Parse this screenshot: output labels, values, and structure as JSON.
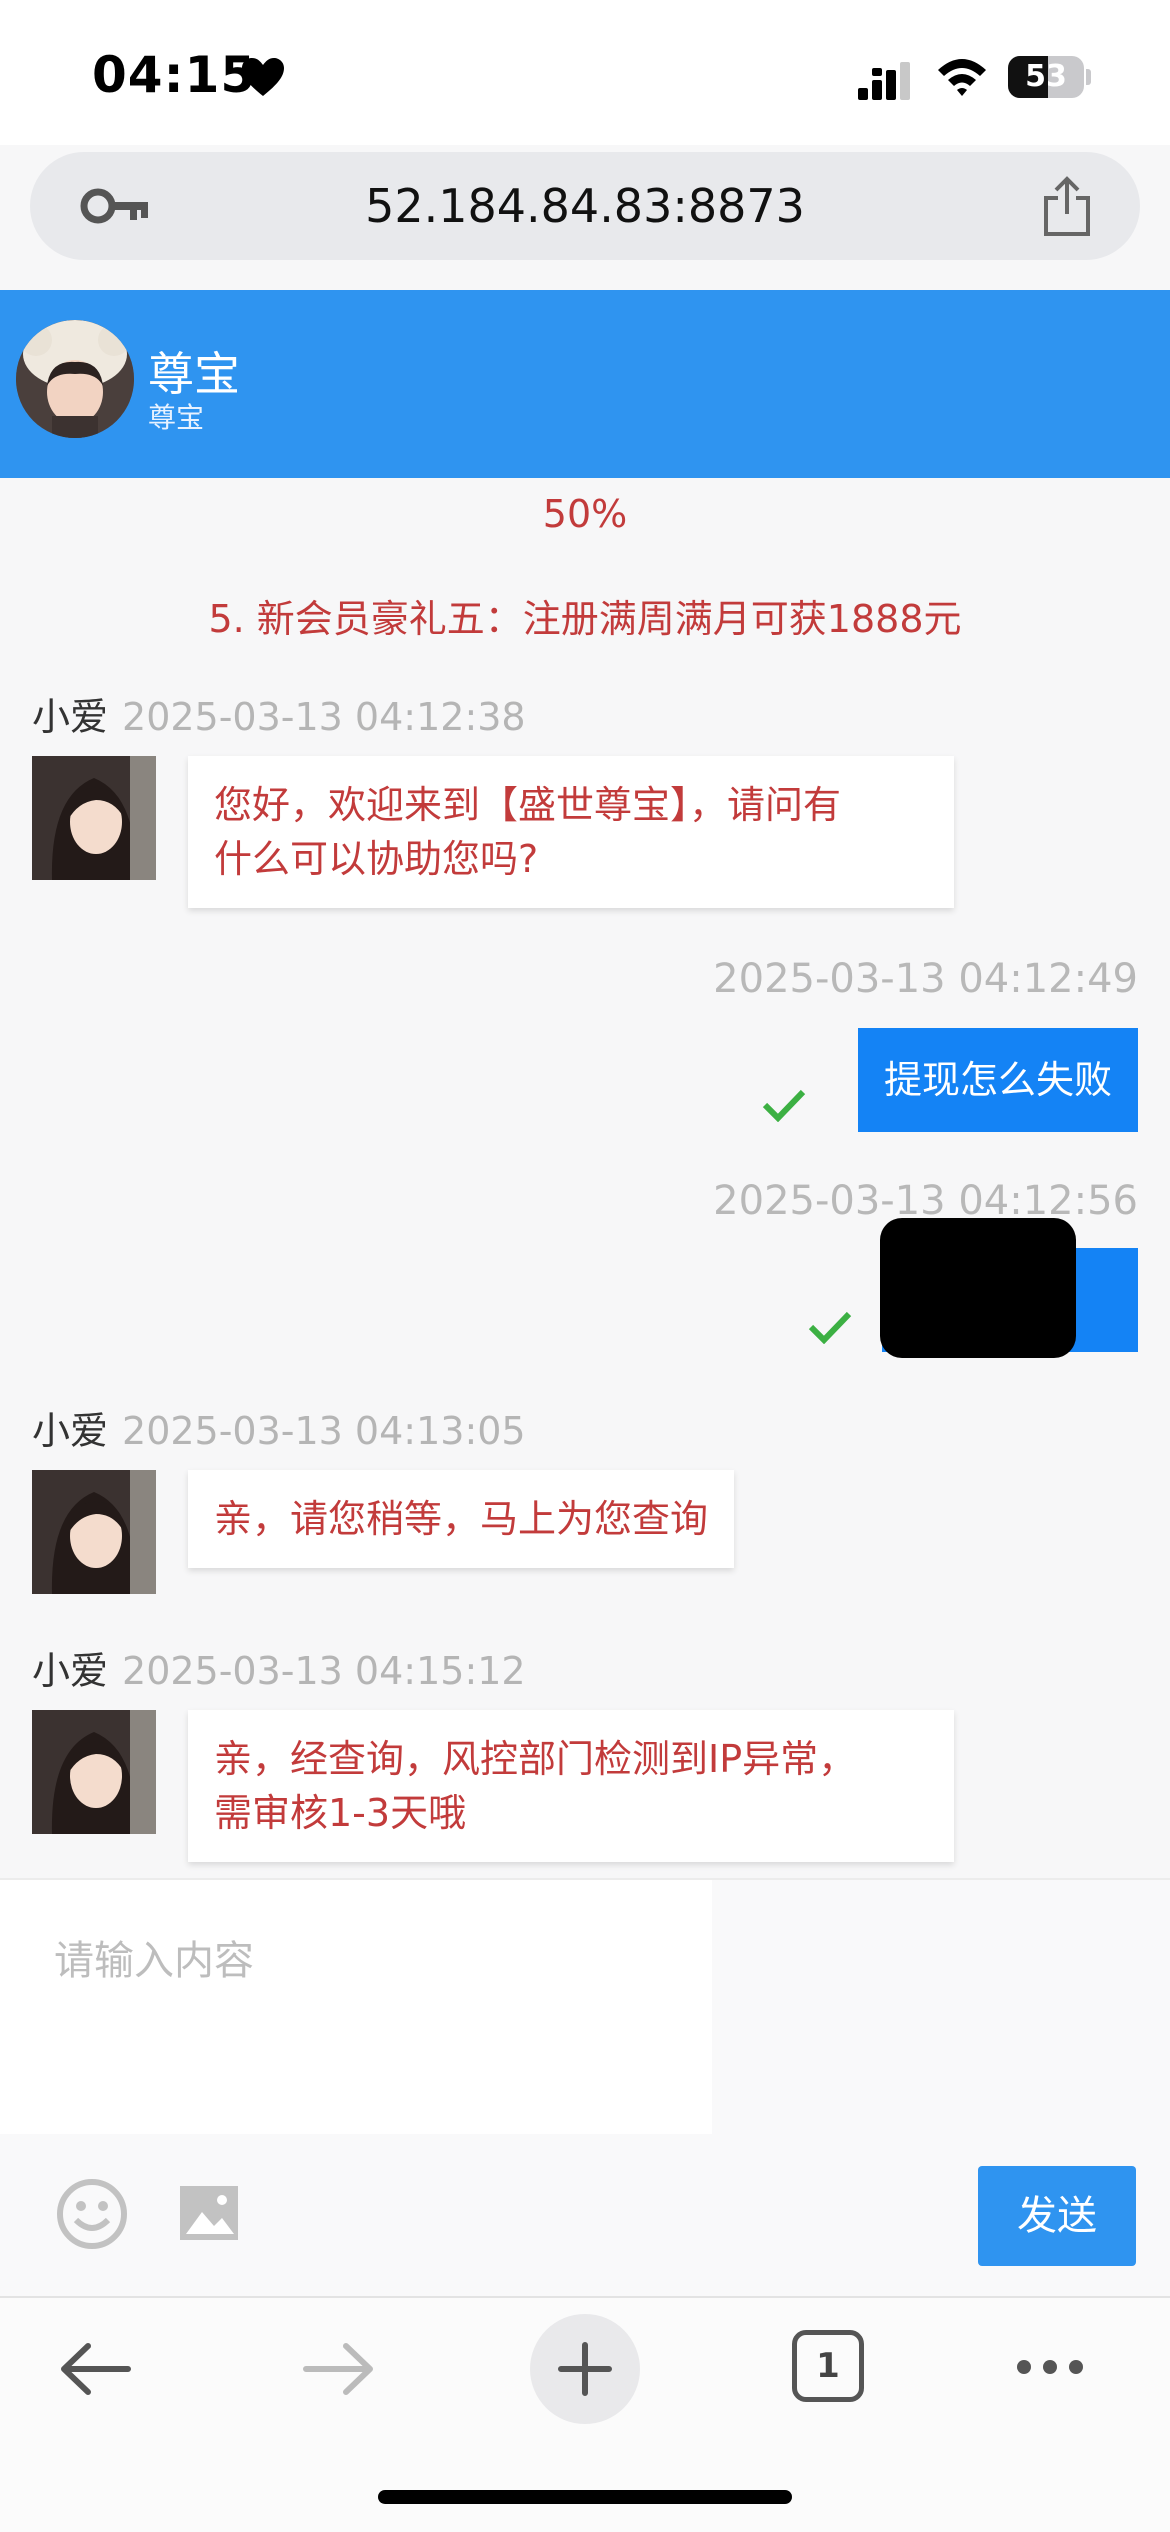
{
  "status_bar": {
    "time": "04:15",
    "battery": "53",
    "battery_level": 0.53
  },
  "browser": {
    "url": "52.184.84.83:8873",
    "tab_count": "1"
  },
  "chat_header": {
    "title": "尊宝",
    "subtitle": "尊宝"
  },
  "notices": {
    "percent": "50%",
    "promo": "5. 新会员豪礼五：注册满周满月可获1888元"
  },
  "messages": [
    {
      "sender": "小爱",
      "time": "2025-03-13 04:12:38",
      "lines": [
        "您好，欢迎来到【盛世尊宝】，请问有",
        "什么可以协助您吗?"
      ]
    },
    {
      "time": "2025-03-13 04:12:49",
      "text": "提现怎么失败"
    },
    {
      "time": "2025-03-13 04:12:56",
      "text": ""
    },
    {
      "sender": "小爱",
      "time": "2025-03-13 04:13:05",
      "lines": [
        "亲，请您稍等，马上为您查询"
      ]
    },
    {
      "sender": "小爱",
      "time": "2025-03-13 04:15:12",
      "lines": [
        "亲，经查询，风控部门检测到IP异常，",
        "需审核1-3天哦"
      ]
    }
  ],
  "input": {
    "placeholder": "请输入内容",
    "send_label": "发送"
  },
  "icons": {
    "heart": "heart-icon",
    "signal": "signal-icon",
    "wifi": "wifi-icon",
    "key": "key-icon",
    "share": "share-icon",
    "emoji": "emoji-icon",
    "image": "image-icon",
    "back": "arrow-left-icon",
    "forward": "arrow-right-icon",
    "add_tab": "plus-icon",
    "more": "more-icon",
    "check": "check-icon"
  },
  "colors": {
    "header_bg": "#2F94F0",
    "sent_bubble": "#1483F5",
    "incoming_text": "#C23B3B",
    "check": "#3CB043"
  }
}
